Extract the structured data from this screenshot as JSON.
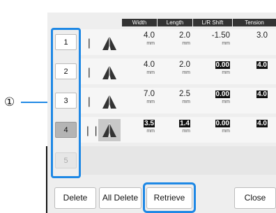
{
  "callout": "①",
  "headers": [
    "Width",
    "Length",
    "L/R Shift",
    "Tension"
  ],
  "rows": [
    {
      "num": "1",
      "needle": "single",
      "width": "4.0",
      "length": "2.0",
      "shift": "-1.50",
      "tension": "3.0",
      "width_unit": "mm",
      "length_unit": "mm",
      "shift_unit": "mm"
    },
    {
      "num": "2",
      "needle": "single",
      "width": "4.0",
      "length": "2.0",
      "shift": "0.00",
      "tension": "4.0",
      "width_unit": "mm",
      "length_unit": "mm",
      "shift_unit": "mm"
    },
    {
      "num": "3",
      "needle": "single",
      "width": "7.0",
      "length": "2.5",
      "shift": "0.00",
      "tension": "4.0",
      "width_unit": "mm",
      "length_unit": "mm",
      "shift_unit": "mm"
    },
    {
      "num": "4",
      "needle": "twin",
      "width": "3.5",
      "length": "1.4",
      "shift": "0.00",
      "tension": "4.0",
      "width_unit": "mm",
      "length_unit": "mm",
      "shift_unit": "mm"
    },
    {
      "num": "5"
    }
  ],
  "buttons": {
    "delete": "Delete",
    "all_delete": "All Delete",
    "retrieve": "Retrieve",
    "close": "Close"
  },
  "colors": {
    "highlight": "#1e88e5",
    "header_bg": "#333333"
  }
}
